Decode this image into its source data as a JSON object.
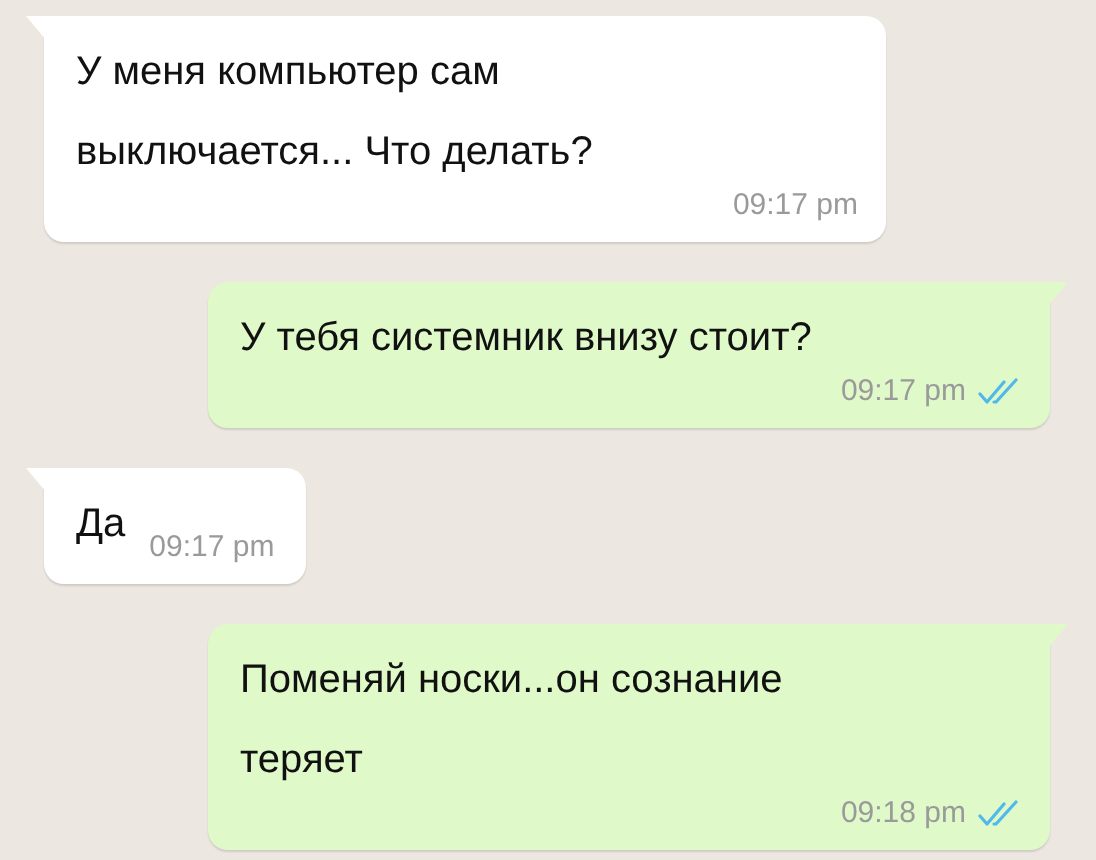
{
  "messages": [
    {
      "outgoing": false,
      "kind": "long",
      "text": "У меня компьютер сам\nвыключается... Что делать?",
      "time": "09:17 pm"
    },
    {
      "outgoing": true,
      "kind": "long",
      "text": "У тебя системник внизу стоит?",
      "time": "09:17 pm",
      "read": true
    },
    {
      "outgoing": false,
      "kind": "short",
      "text": "Да",
      "time": "09:17 pm"
    },
    {
      "outgoing": true,
      "kind": "long",
      "text": "Поменяй носки...он сознание\nтеряет",
      "time": "09:18 pm",
      "read": true
    }
  ]
}
